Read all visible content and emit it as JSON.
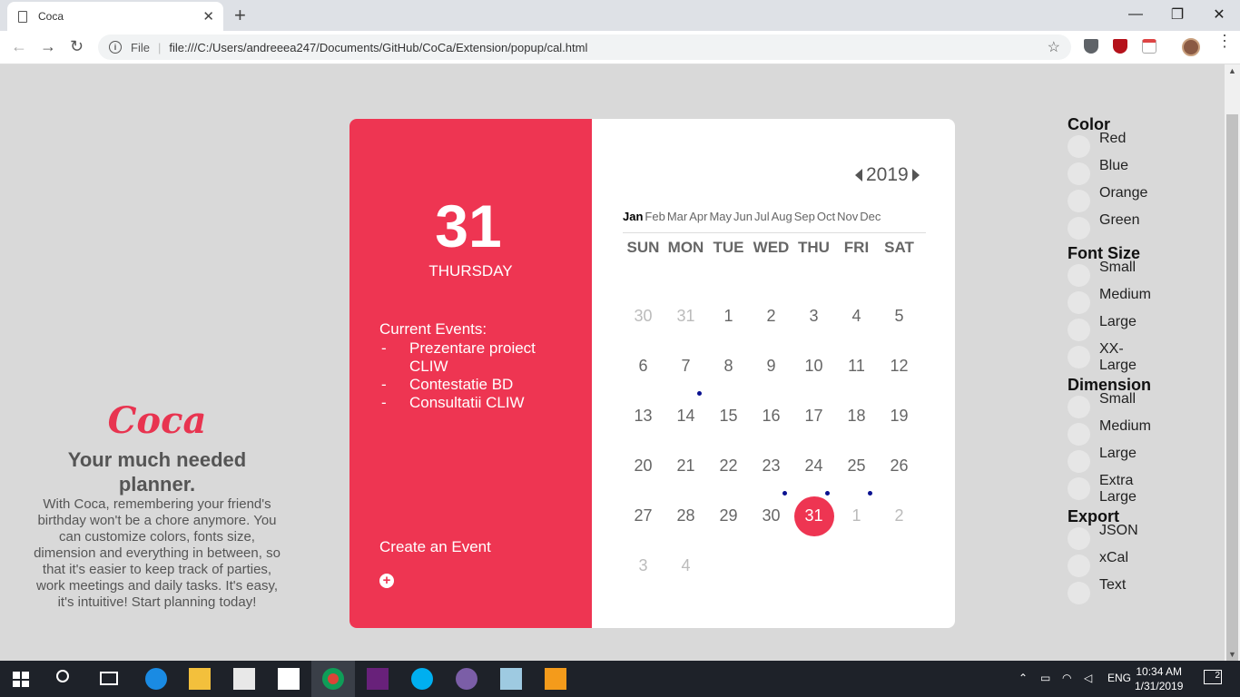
{
  "browser": {
    "tab_title": "Coca",
    "tab_close": "✕",
    "new_tab": "+",
    "minimize": "—",
    "restore": "❐",
    "close": "✕",
    "back": "←",
    "forward": "→",
    "reload": "↻",
    "info": "i",
    "scheme": "File",
    "url": "file:///C:/Users/andreeea247/Documents/GitHub/CoCa/Extension/popup/cal.html",
    "star": "☆",
    "menu": "⋮"
  },
  "intro": {
    "brand": "Coca",
    "tagline": "Your much needed planner.",
    "description": "With Coca, remembering your friend's birthday won't be a chore anymore. You can customize colors, fonts size, dimension and everything in between, so that it's easier to keep track of parties, work meetings and daily tasks. It's easy, it's intuitive! Start planning today!"
  },
  "calendar": {
    "selected_day": "31",
    "selected_weekday": "THURSDAY",
    "events_title": "Current Events:",
    "events": [
      {
        "dash": "-",
        "text": "Prezentare proiect CLIW"
      },
      {
        "dash": "-",
        "text": "Contestatie BD"
      },
      {
        "dash": "-",
        "text": "Consultatii CLIW"
      }
    ],
    "create_label": "Create an Event",
    "create_icon": "+",
    "year": "2019",
    "months": [
      "Jan",
      "Feb",
      "Mar",
      "Apr",
      "May",
      "Jun",
      "Jul",
      "Aug",
      "Sep",
      "Oct",
      "Nov",
      "Dec"
    ],
    "active_month_index": 0,
    "weekdays": [
      "SUN",
      "MON",
      "TUE",
      "WED",
      "THU",
      "FRI",
      "SAT"
    ],
    "days": [
      {
        "d": "30",
        "muted": true
      },
      {
        "d": "31",
        "muted": true
      },
      {
        "d": "1"
      },
      {
        "d": "2"
      },
      {
        "d": "3"
      },
      {
        "d": "4"
      },
      {
        "d": "5"
      },
      {
        "d": "6"
      },
      {
        "d": "7"
      },
      {
        "d": "8"
      },
      {
        "d": "9"
      },
      {
        "d": "10"
      },
      {
        "d": "11"
      },
      {
        "d": "12"
      },
      {
        "d": "13"
      },
      {
        "d": "14",
        "event": true
      },
      {
        "d": "15"
      },
      {
        "d": "16"
      },
      {
        "d": "17"
      },
      {
        "d": "18"
      },
      {
        "d": "19"
      },
      {
        "d": "20"
      },
      {
        "d": "21"
      },
      {
        "d": "22"
      },
      {
        "d": "23"
      },
      {
        "d": "24"
      },
      {
        "d": "25"
      },
      {
        "d": "26"
      },
      {
        "d": "27"
      },
      {
        "d": "28"
      },
      {
        "d": "29"
      },
      {
        "d": "30",
        "event": true
      },
      {
        "d": "31",
        "today": true,
        "event": true
      },
      {
        "d": "1",
        "muted": true,
        "event": true
      },
      {
        "d": "2",
        "muted": true
      },
      {
        "d": "3",
        "muted": true
      },
      {
        "d": "4",
        "muted": true
      }
    ],
    "accent_color": "#ee3552",
    "event_dot_color": "#0a1190"
  },
  "settings": {
    "groups": [
      {
        "title": "Color",
        "options": [
          "Red",
          "Blue",
          "Orange",
          "Green"
        ]
      },
      {
        "title": "Font Size",
        "options": [
          "Small",
          "Medium",
          "Large",
          "XX-Large"
        ]
      },
      {
        "title": "Dimension",
        "options": [
          "Small",
          "Medium",
          "Large",
          "Extra Large"
        ]
      },
      {
        "title": "Export",
        "options": [
          "JSON",
          "xCal",
          "Text"
        ]
      }
    ]
  },
  "taskbar": {
    "language": "ENG",
    "time": "10:34 AM",
    "date": "1/31/2019",
    "notifications": "2"
  }
}
